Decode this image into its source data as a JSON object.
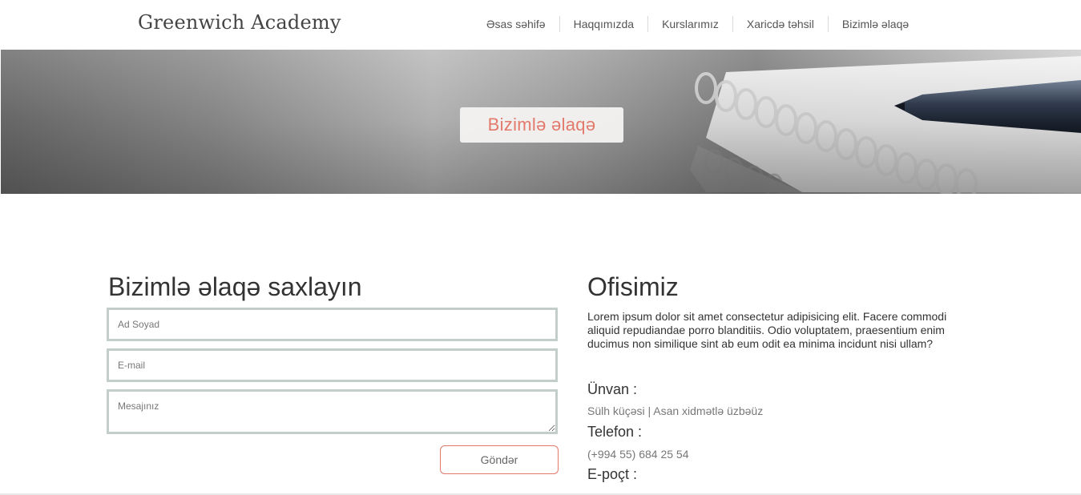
{
  "header": {
    "logo": "Greenwich Academy",
    "nav": [
      "Əsas səhifə",
      "Haqqımızda",
      "Kurslarımız",
      "Xaricdə təhsil",
      "Bizimlə əlaqə"
    ]
  },
  "hero": {
    "title": "Bizimlə əlaqə"
  },
  "contact_form": {
    "title": "Bizimlə əlaqə saxlayın",
    "name_placeholder": "Ad Soyad",
    "email_placeholder": "E-mail",
    "message_placeholder": "Mesajınız",
    "submit_label": "Göndər"
  },
  "office": {
    "title": "Ofisimiz",
    "description": "Lorem ipsum dolor sit amet consectetur adipisicing elit. Facere commodi aliquid repudiandae porro blanditiis. Odio voluptatem, praesentium enim ducimus non similique sint ab eum odit ea minima incidunt nisi ullam?",
    "address_label": "Ünvan :",
    "address_value": "Sülh küçəsi | Asan xidmətlə üzbəüz",
    "phone_label": "Telefon :",
    "phone_value": "(+994 55) 684 25 54",
    "email_label": "E-poçt :"
  },
  "colors": {
    "accent": "#e3796b",
    "field_border": "#c3cdca",
    "text": "#333333"
  }
}
